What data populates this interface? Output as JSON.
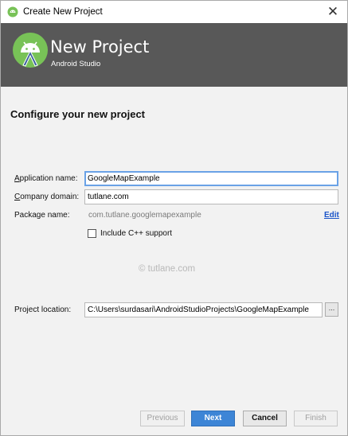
{
  "window": {
    "title": "Create New Project",
    "close_glyph": "✕"
  },
  "header": {
    "title": "New Project",
    "subtitle": "Android Studio",
    "logo_icon": "android-studio-logo-icon"
  },
  "form": {
    "section_title": "Configure your new project",
    "application_name": {
      "label_first": "A",
      "label_rest": "pplication name:",
      "value": "GoogleMapExample"
    },
    "company_domain": {
      "label_first": "C",
      "label_rest": "ompany domain:",
      "value": "tutlane.com"
    },
    "package_name": {
      "label": "Package name:",
      "value": "com.tutlane.googlemapexample",
      "edit_label": "Edit"
    },
    "include_cpp": {
      "label": "Include C++ support",
      "checked": false
    },
    "project_location": {
      "label": "Project location:",
      "value": "C:\\Users\\surdasari\\AndroidStudioProjects\\GoogleMapExample",
      "browse_label": "..."
    }
  },
  "watermark": "© tutlane.com",
  "buttons": {
    "previous": "Previous",
    "next": "Next",
    "cancel": "Cancel",
    "finish": "Finish"
  },
  "colors": {
    "header_bg": "#585858",
    "accent_blue": "#3d85d6",
    "android_green": "#78c257"
  }
}
